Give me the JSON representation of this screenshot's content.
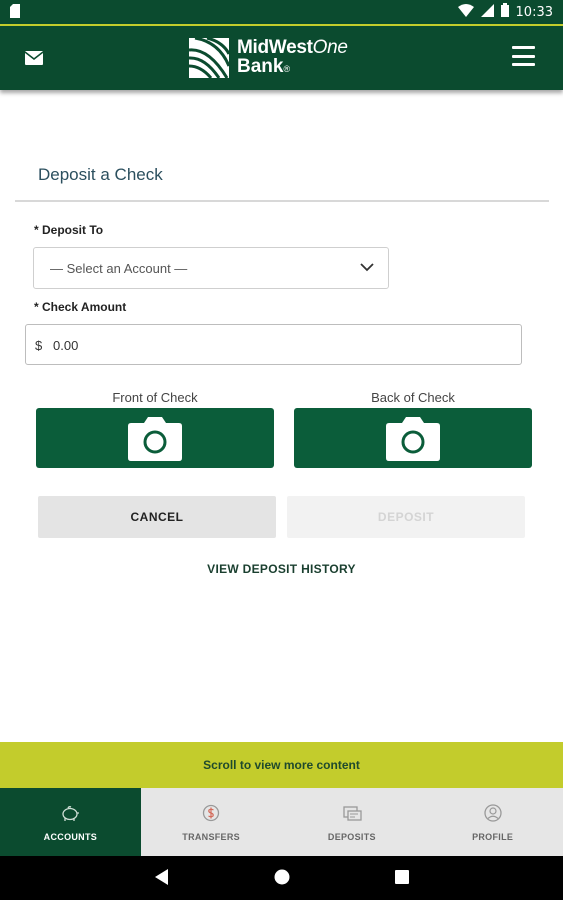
{
  "status_bar": {
    "time": "10:33",
    "icons": [
      "sim-card-icon",
      "wifi-icon",
      "signal-icon",
      "battery-icon"
    ]
  },
  "header": {
    "brand_line1_bold": "MidWest",
    "brand_line1_italic": "One",
    "brand_line2": "Bank",
    "brand_mark": "®",
    "left_icon": "mail-icon",
    "right_icon": "hamburger-menu-icon"
  },
  "page": {
    "title": "Deposit a Check"
  },
  "form": {
    "deposit_to_label": "* Deposit To",
    "deposit_to_value": "— Select an Account —",
    "check_amount_label": "* Check Amount",
    "currency_symbol": "$",
    "amount_value": "0.00",
    "front_label": "Front of Check",
    "back_label": "Back of Check"
  },
  "actions": {
    "cancel_label": "CANCEL",
    "deposit_label": "DEPOSIT",
    "history_label": "VIEW DEPOSIT HISTORY"
  },
  "banner": {
    "text": "Scroll to view more content"
  },
  "tabs": [
    {
      "label": "ACCOUNTS",
      "icon": "piggy-bank-icon",
      "active": true
    },
    {
      "label": "TRANSFERS",
      "icon": "dollar-transfer-icon",
      "active": false
    },
    {
      "label": "DEPOSITS",
      "icon": "check-deposit-icon",
      "active": false
    },
    {
      "label": "PROFILE",
      "icon": "profile-icon",
      "active": false
    }
  ],
  "colors": {
    "brand_green": "#0b4b2f",
    "button_green": "#0b5d3a",
    "accent_lime": "#c3cc2c",
    "tab_bar_bg": "#e6e6e6"
  }
}
